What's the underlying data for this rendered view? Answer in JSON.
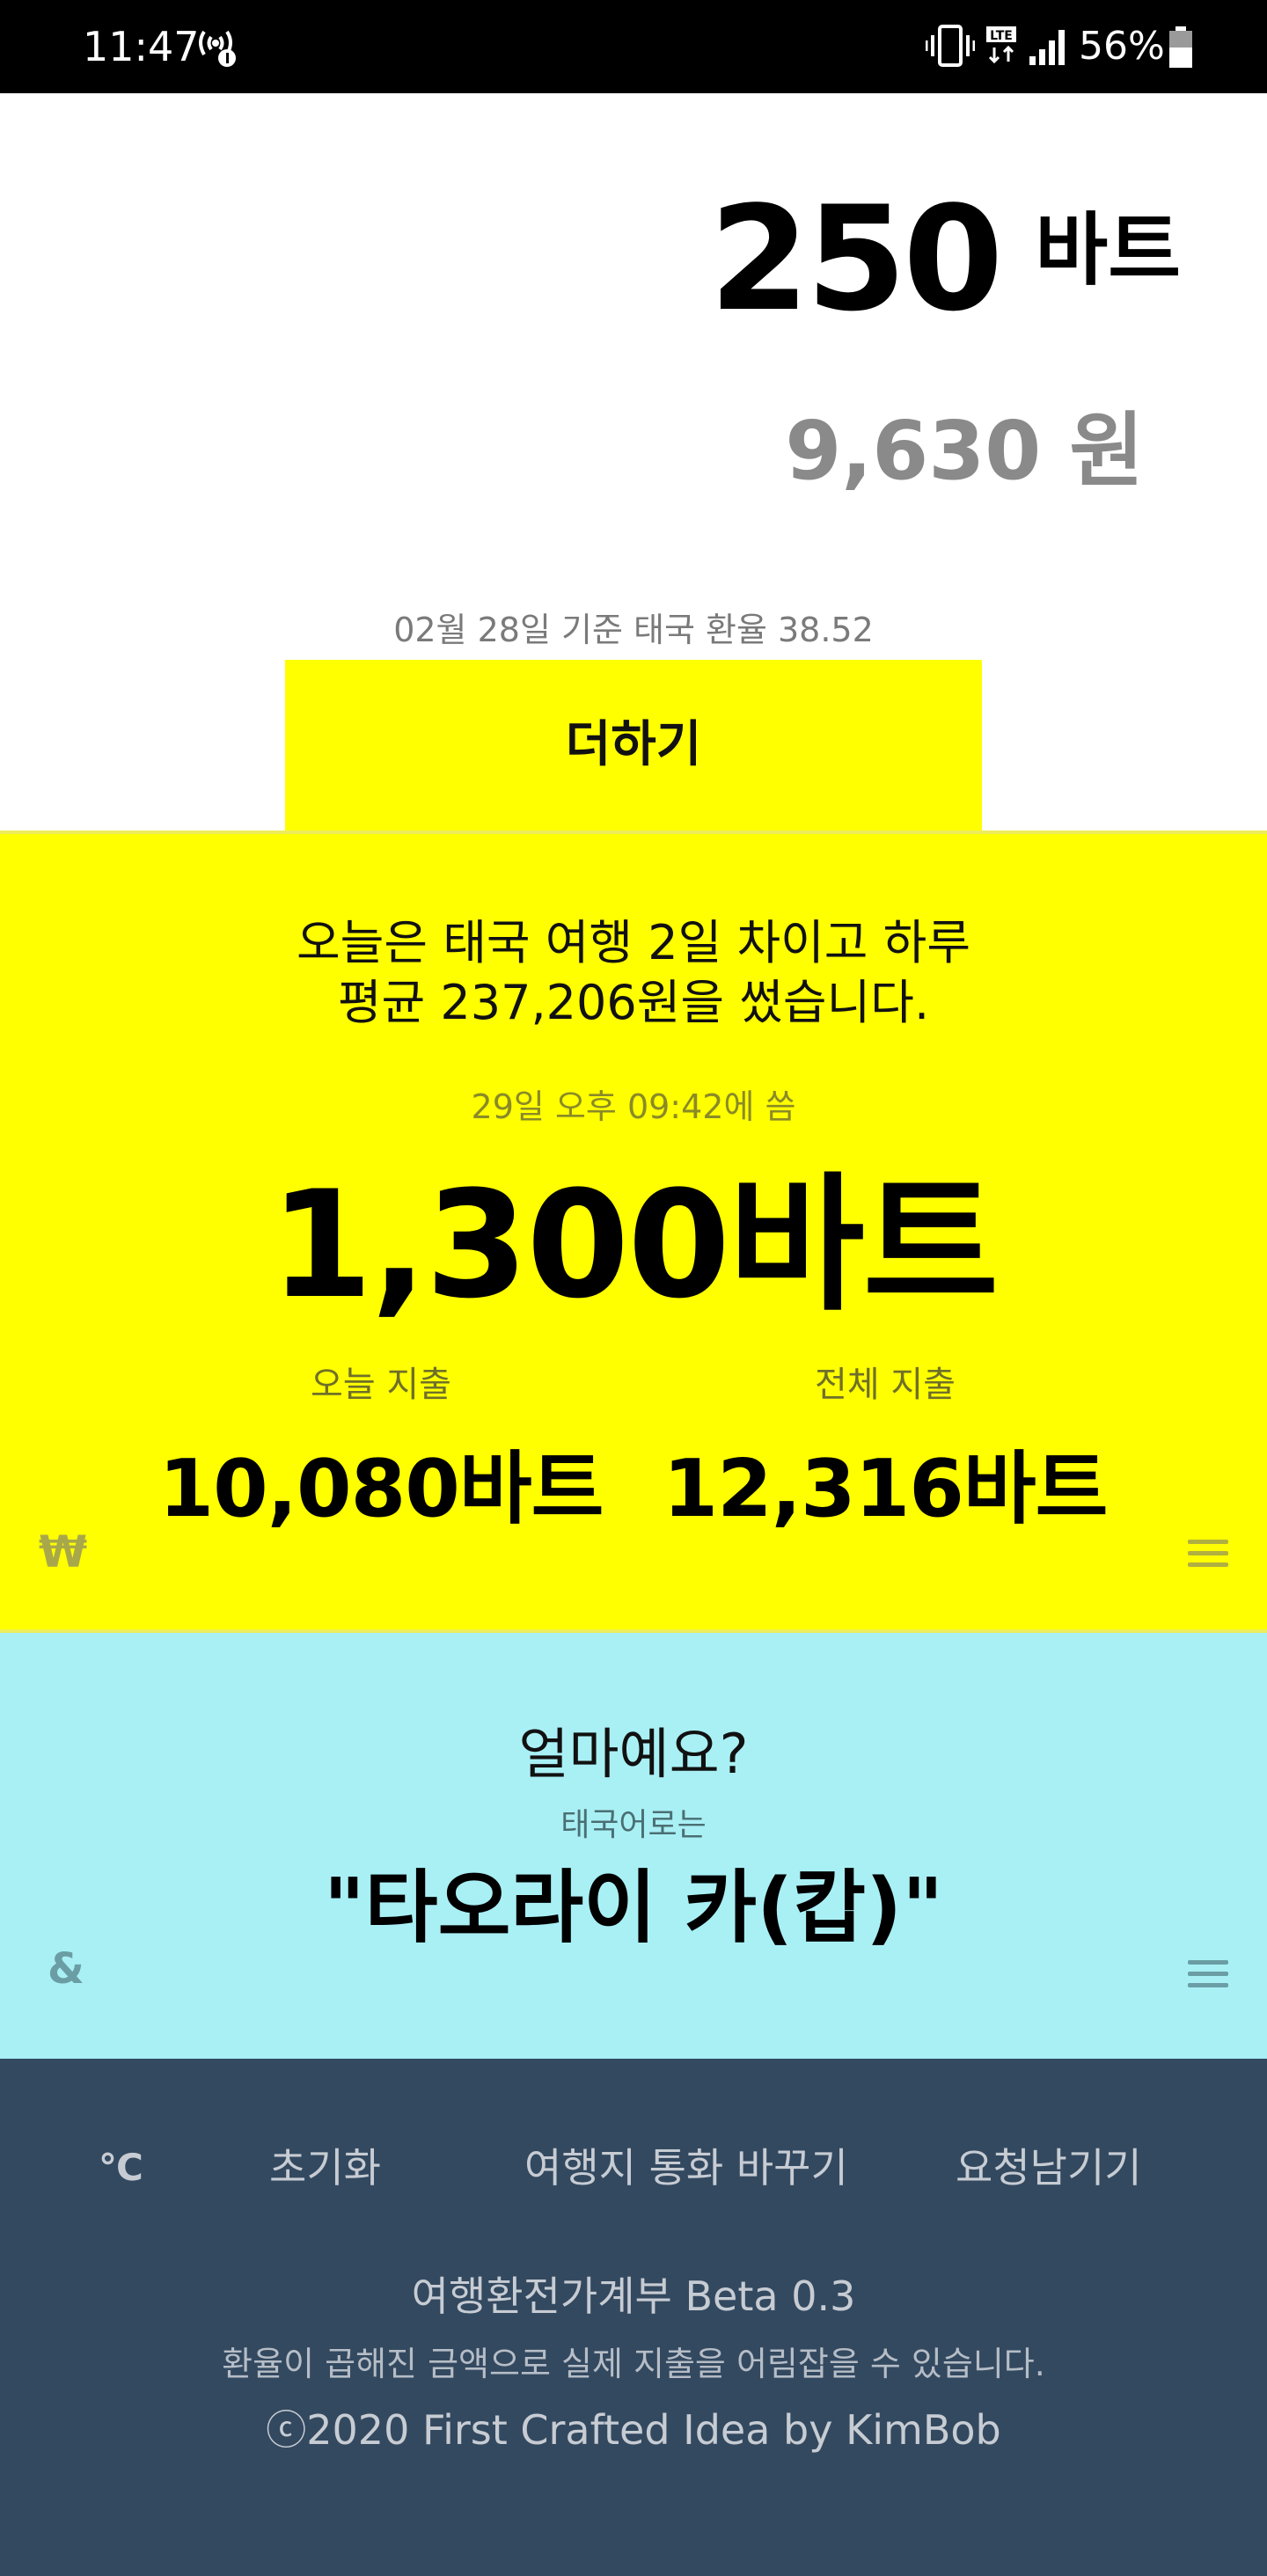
{
  "status_bar": {
    "time": "11:47",
    "battery_percent": "56%",
    "network": "LTE",
    "icons": [
      "hotspot-icon",
      "vibrate-icon",
      "lte-icon",
      "signal-icon",
      "battery-icon"
    ]
  },
  "converter": {
    "amount": "250",
    "unit": "바트",
    "won_amount": "9,630 원",
    "rate_note": "02월 28일 기준 태국 환율 38.52",
    "add_label": "더하기"
  },
  "summary": {
    "line1": "오늘은 태국 여행 2일 차이고 하루",
    "line2": "평균 237,206원을 썼습니다.",
    "last_spent_time": "29일 오후 09:42에 씀",
    "last_amount": "1,300바트",
    "today_label": "오늘 지출",
    "today_value": "10,080바트",
    "total_label": "전체 지출",
    "total_value": "12,316바트",
    "won_toggle": "₩"
  },
  "phrase": {
    "question": "얼마예요?",
    "subtitle": "태국어로는",
    "translation": "\"타오라이 카(캅)\"",
    "toggle": "&"
  },
  "footer": {
    "buttons": {
      "celsius": "℃",
      "reset": "초기화",
      "change_currency": "여행지 통화 바꾸기",
      "request": "요청남기기"
    },
    "app_name": "여행환전가계부 Beta 0.3",
    "description": "환율이 곱해진 금액으로 실제 지출을 어림잡을 수 있습니다.",
    "copyright": "ⓒ2020 First Crafted Idea by KimBob"
  },
  "colors": {
    "status_bar": "#000000",
    "accent_yellow": "#ffff00",
    "phrase_cyan": "#a9f0f5",
    "footer": "#334960",
    "won_gray": "#8a8a8a"
  }
}
